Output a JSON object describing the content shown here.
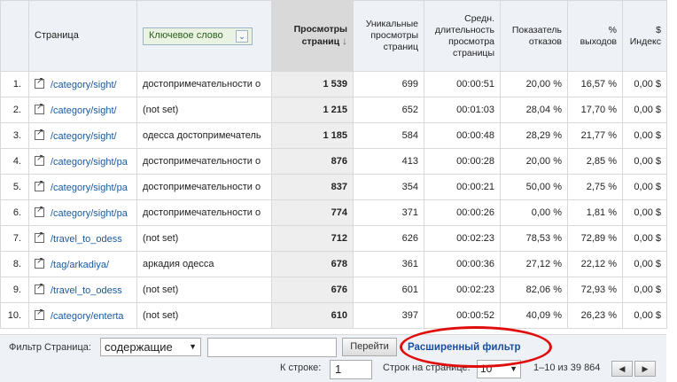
{
  "table": {
    "headers": {
      "page": "Страница",
      "keyword_select": "Ключевое слово",
      "pageviews": "Просмотры страниц",
      "unique": "Уникальные просмотры страниц",
      "avg_time": "Средн. длительность просмотра страницы",
      "bounce": "Показатель отказов",
      "exit": "% выходов",
      "index": "$ Индекс"
    },
    "rows": [
      {
        "n": "1.",
        "page": "/category/sight/",
        "kw": "достопримечательности о",
        "pv": "1 539",
        "upv": "699",
        "time": "00:00:51",
        "bounce": "20,00 %",
        "exit": "16,57 %",
        "idx": "0,00 $"
      },
      {
        "n": "2.",
        "page": "/category/sight/",
        "kw": "(not set)",
        "pv": "1 215",
        "upv": "652",
        "time": "00:01:03",
        "bounce": "28,04 %",
        "exit": "17,70 %",
        "idx": "0,00 $"
      },
      {
        "n": "3.",
        "page": "/category/sight/",
        "kw": "одесса достопримечатель",
        "pv": "1 185",
        "upv": "584",
        "time": "00:00:48",
        "bounce": "28,29 %",
        "exit": "21,77 %",
        "idx": "0,00 $"
      },
      {
        "n": "4.",
        "page": "/category/sight/pa",
        "kw": "достопримечательности о",
        "pv": "876",
        "upv": "413",
        "time": "00:00:28",
        "bounce": "20,00 %",
        "exit": "2,85 %",
        "idx": "0,00 $"
      },
      {
        "n": "5.",
        "page": "/category/sight/pa",
        "kw": "достопримечательности о",
        "pv": "837",
        "upv": "354",
        "time": "00:00:21",
        "bounce": "50,00 %",
        "exit": "2,75 %",
        "idx": "0,00 $"
      },
      {
        "n": "6.",
        "page": "/category/sight/pa",
        "kw": "достопримечательности о",
        "pv": "774",
        "upv": "371",
        "time": "00:00:26",
        "bounce": "0,00 %",
        "exit": "1,81 %",
        "idx": "0,00 $"
      },
      {
        "n": "7.",
        "page": "/travel_to_odess",
        "kw": "(not set)",
        "pv": "712",
        "upv": "626",
        "time": "00:02:23",
        "bounce": "78,53 %",
        "exit": "72,89 %",
        "idx": "0,00 $"
      },
      {
        "n": "8.",
        "page": "/tag/arkadiya/",
        "kw": "аркадия одесса",
        "pv": "678",
        "upv": "361",
        "time": "00:00:36",
        "bounce": "27,12 %",
        "exit": "22,12 %",
        "idx": "0,00 $"
      },
      {
        "n": "9.",
        "page": "/travel_to_odess",
        "kw": "(not set)",
        "pv": "676",
        "upv": "601",
        "time": "00:02:23",
        "bounce": "82,06 %",
        "exit": "72,93 %",
        "idx": "0,00 $"
      },
      {
        "n": "10.",
        "page": "/category/enterta",
        "kw": "(not set)",
        "pv": "610",
        "upv": "397",
        "time": "00:00:52",
        "bounce": "40,09 %",
        "exit": "26,23 %",
        "idx": "0,00 $"
      }
    ]
  },
  "footer": {
    "filter_label": "Фильтр Страница:",
    "filter_mode": "содержащие",
    "filter_value": "",
    "go_button": "Перейти",
    "advanced_filter": "Расширенный фильтр",
    "goto_label": "К строке:",
    "goto_value": "1",
    "rows_label": "Строк на странице:",
    "rows_value": "10",
    "range_text": "1–10 из 39 864"
  },
  "colors": {
    "link": "#1a5aa0",
    "highlight_oval": "#e00d0d",
    "sorted_column": "#d9d9d9"
  }
}
